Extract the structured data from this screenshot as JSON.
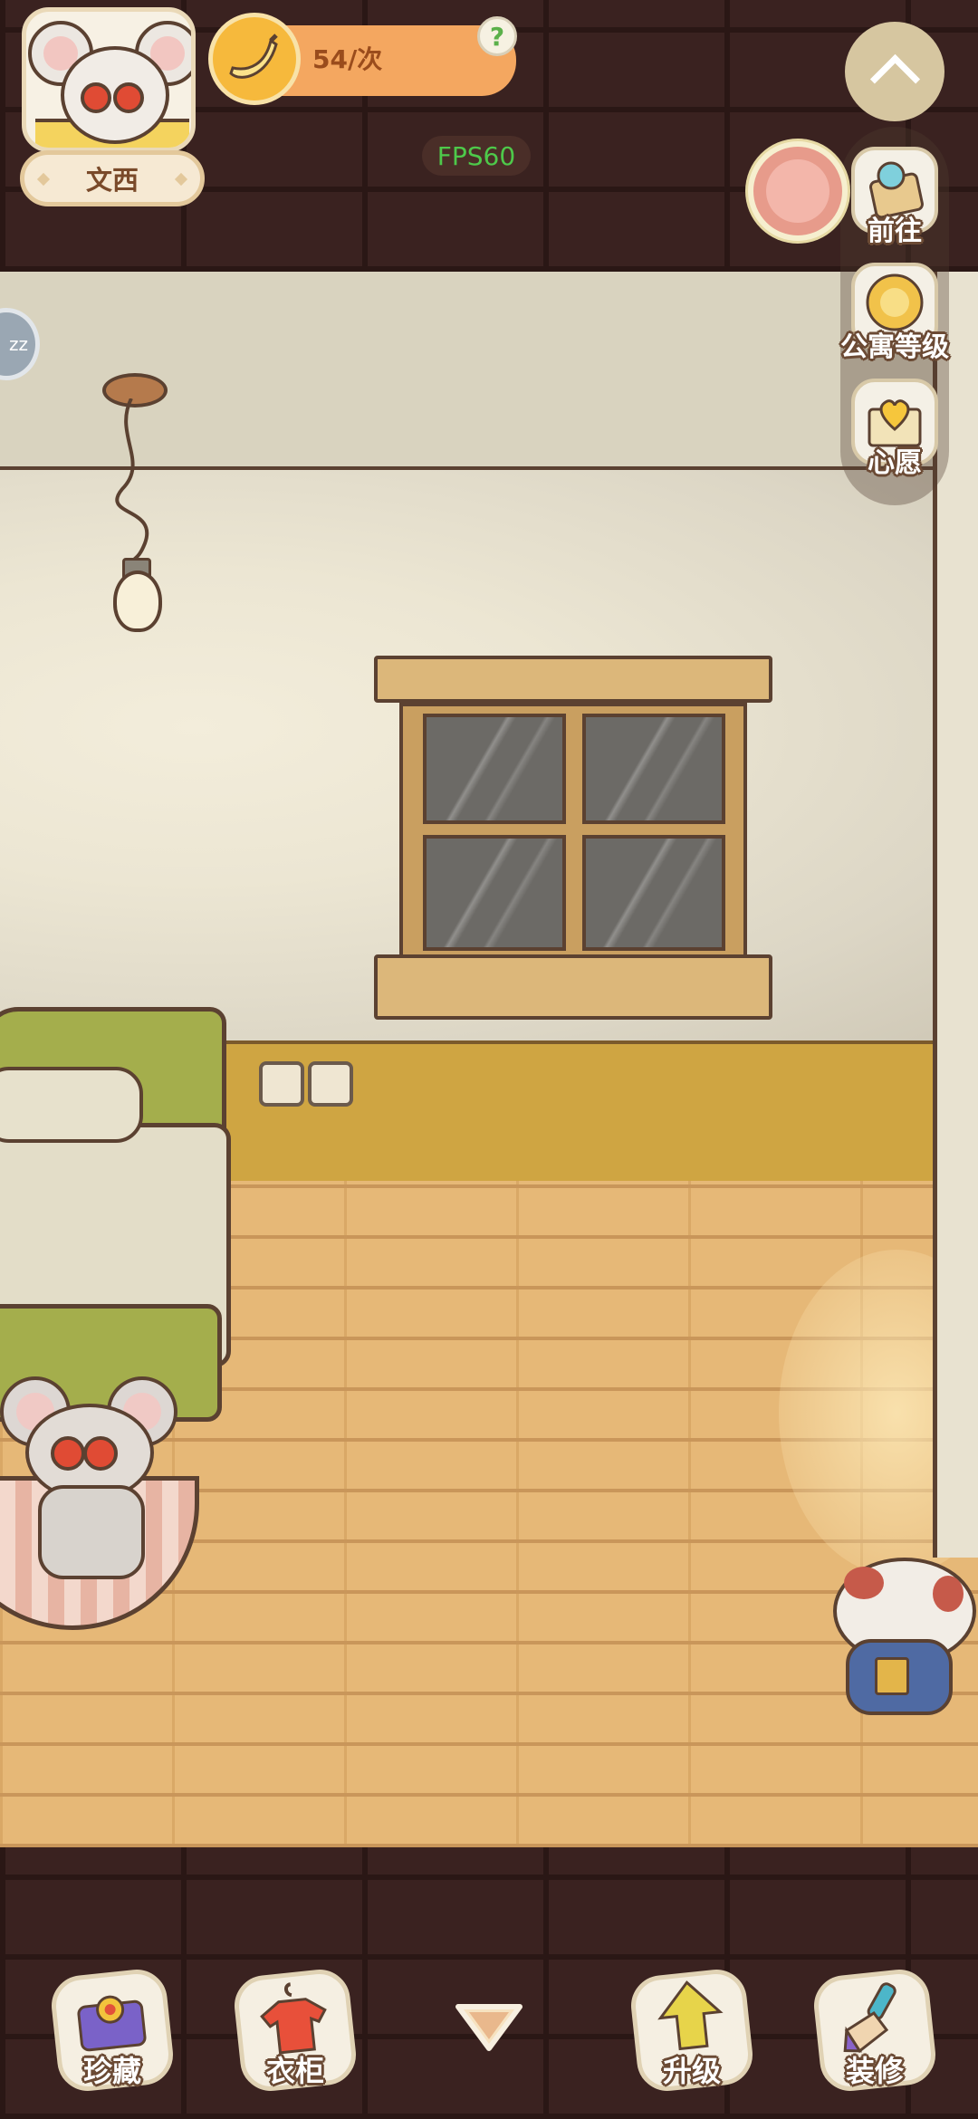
{
  "player": {
    "name": "文西"
  },
  "energy": {
    "cost_text": "54/次",
    "help_icon": "?"
  },
  "debug": {
    "fps": "FPS60"
  },
  "side_menu": [
    {
      "id": "goto",
      "label": "前往",
      "icon": "map-pin-icon"
    },
    {
      "id": "apartment_level",
      "label": "公寓等级",
      "icon": "cat-badge-icon"
    },
    {
      "id": "wish",
      "label": "心愿",
      "icon": "heart-book-icon"
    }
  ],
  "sleep_button": {
    "text": "zz"
  },
  "toolbar": {
    "treasure": "珍藏",
    "wardrobe": "衣柜",
    "upgrade": "升级",
    "decorate": "装修"
  },
  "colors": {
    "brick": "#3a2220",
    "wall": "#ece6d3",
    "floor": "#e6b877",
    "wainscot": "#cfa542",
    "accent_orange": "#f4a760",
    "fps_green": "#4ec94a"
  }
}
